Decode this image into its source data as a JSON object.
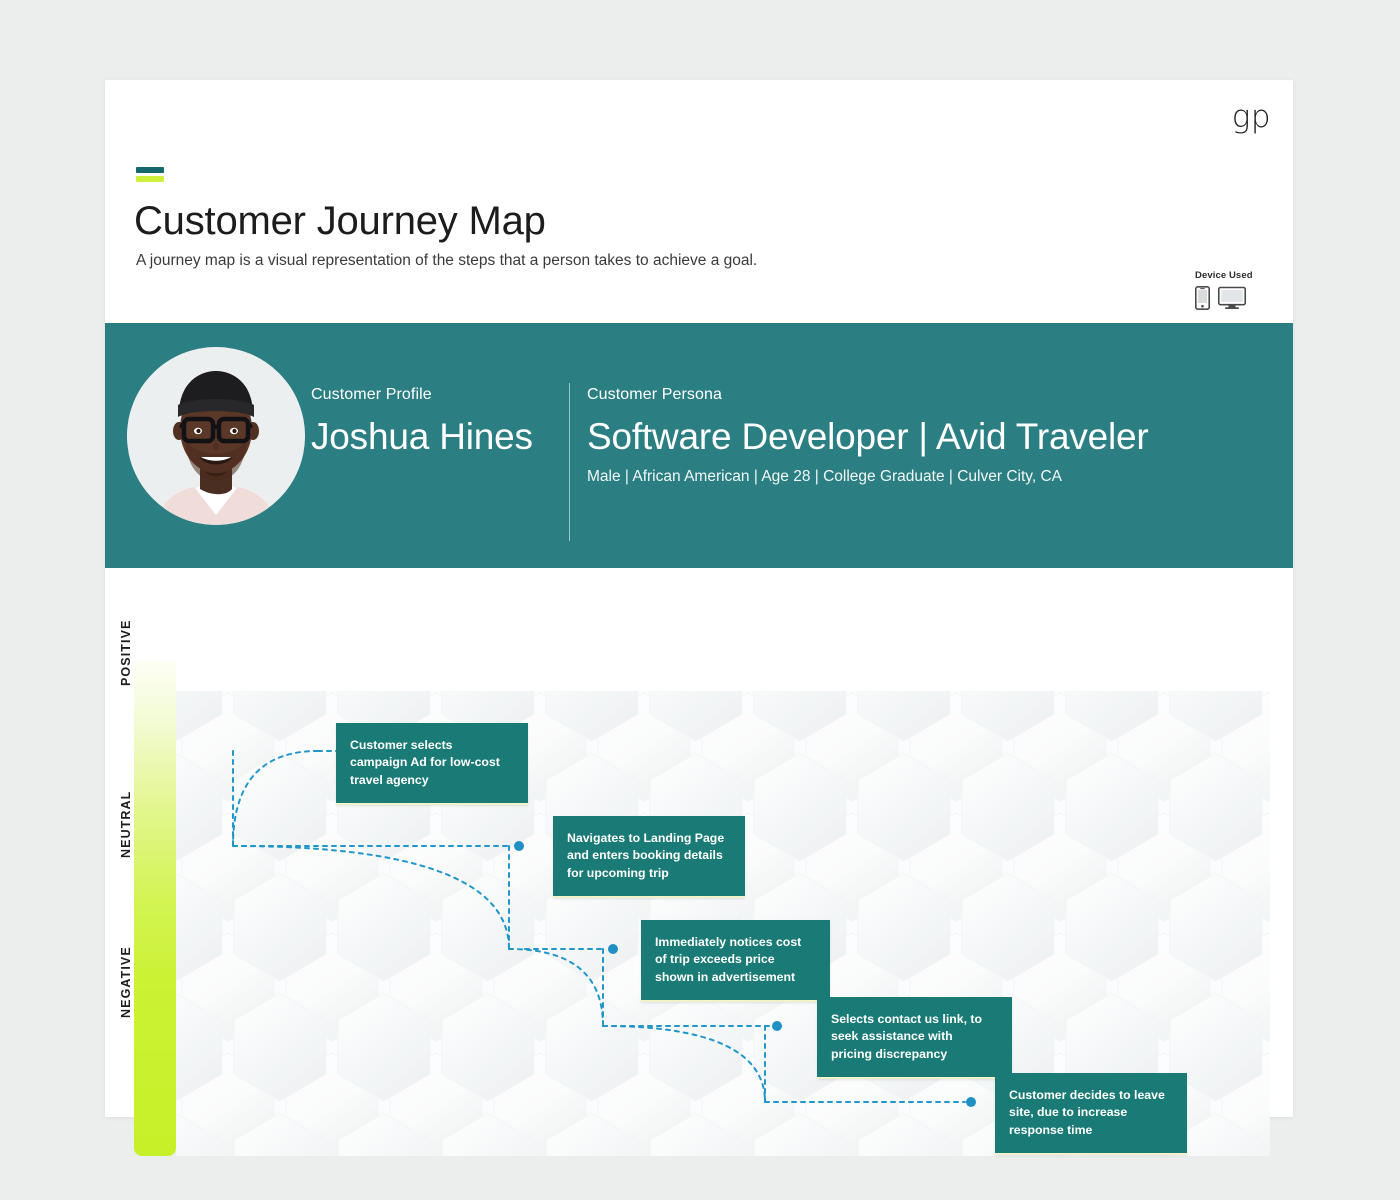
{
  "header": {
    "logo": "gp",
    "title": "Customer Journey Map",
    "subtitle": "A journey map is a visual representation of the steps that a person takes to achieve a goal.",
    "device_label": "Device Used",
    "device_icons": [
      "mobile-phone-icon",
      "desktop-monitor-icon"
    ],
    "accent_colors": [
      "#14686b",
      "#cdf03c"
    ]
  },
  "persona": {
    "profile_kicker": "Customer Profile",
    "profile_name": "Joshua Hines",
    "persona_kicker": "Customer Persona",
    "persona_role": "Software Developer | Avid Traveler",
    "persona_demographics": "Male | African American | Age 28 | College Graduate | Culver City, CA",
    "avatar": "customer-portrait-photo",
    "band_color": "#2b7f82"
  },
  "journey": {
    "sentiment_axis": [
      {
        "label": "POSITIVE"
      },
      {
        "label": "NEUTRAL"
      },
      {
        "label": "NEGATIVE"
      }
    ],
    "gradient_from": "#fdfff6",
    "gradient_to": "#c6f128",
    "box_color": "#1a7a76",
    "connector_color": "#2196c9",
    "steps": [
      {
        "text": "Customer selects campaign Ad for low-cost travel agency",
        "sentiment": "POSITIVE"
      },
      {
        "text": "Navigates to Landing Page and enters booking details for upcoming trip",
        "sentiment": "POSITIVE"
      },
      {
        "text": "Immediately notices cost of trip exceeds price shown in advertisement",
        "sentiment": "NEUTRAL"
      },
      {
        "text": "Selects contact us link, to seek assistance with pricing discrepancy",
        "sentiment": "NEGATIVE"
      },
      {
        "text": "Customer decides to leave site, due to increase response time",
        "sentiment": "NEGATIVE"
      }
    ]
  }
}
